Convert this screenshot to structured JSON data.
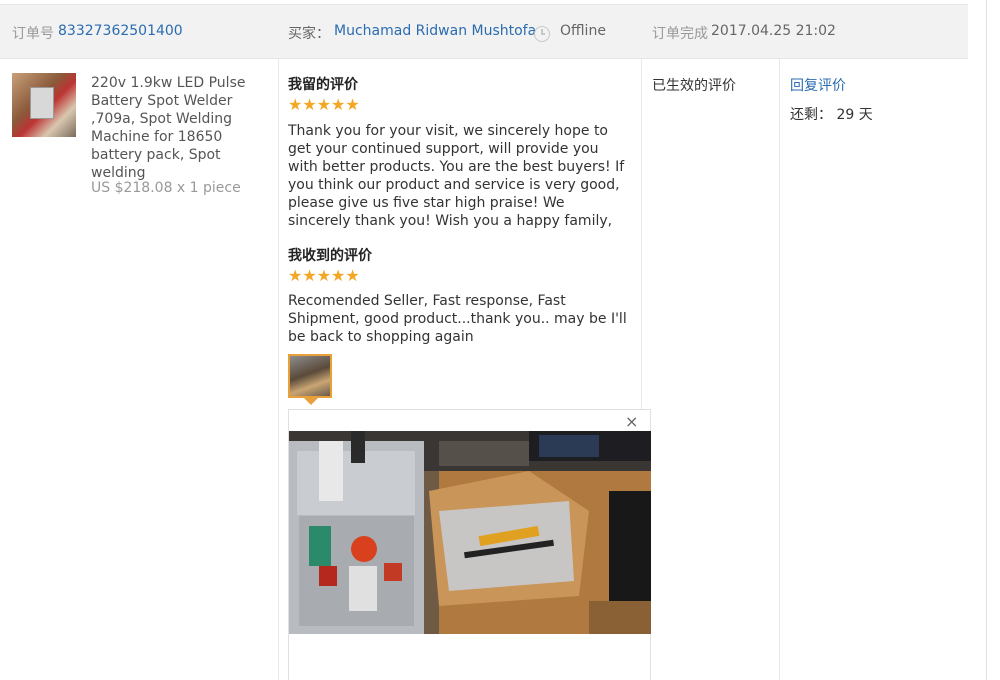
{
  "order": {
    "number_label": "订单号",
    "number": "83327362501400",
    "buyer_label": "买家：",
    "buyer_name": "Muchamad Ridwan Mushtofa",
    "buyer_status": "Offline",
    "completed_label": "订单完成",
    "completed_time": "2017.04.25 21:02"
  },
  "product": {
    "title": "220v 1.9kw LED Pulse Battery Spot Welder ,709a, Spot Welding Machine for 18650 battery pack, Spot welding",
    "price": "US $218.08 x 1 piece"
  },
  "my_feedback": {
    "title": "我留的评价",
    "stars": "★★★★★",
    "rating": 5,
    "text": "Thank you for your visit, we sincerely hope to get your continued support, will provide you with better products. You are the best buyers! If you think our product and service is very good, please give us five star high praise! We sincerely thank you! Wish you a happy family,"
  },
  "received_feedback": {
    "title": "我收到的评价",
    "stars": "★★★★★",
    "rating": 5,
    "text": "Recomended Seller, Fast response, Fast Shipment, good product...thank you.. may be I'll be back to shopping again",
    "close_symbol": "×"
  },
  "status": {
    "effective": "已生效的评价"
  },
  "actions": {
    "reply_label": "回复评价",
    "remaining_label": "还剩：",
    "remaining_value": "29 天"
  },
  "colors": {
    "link": "#2b6cb0",
    "star": "#f5a623",
    "header_bg": "#f2f2f2",
    "thumb_border": "#e8a13a"
  }
}
